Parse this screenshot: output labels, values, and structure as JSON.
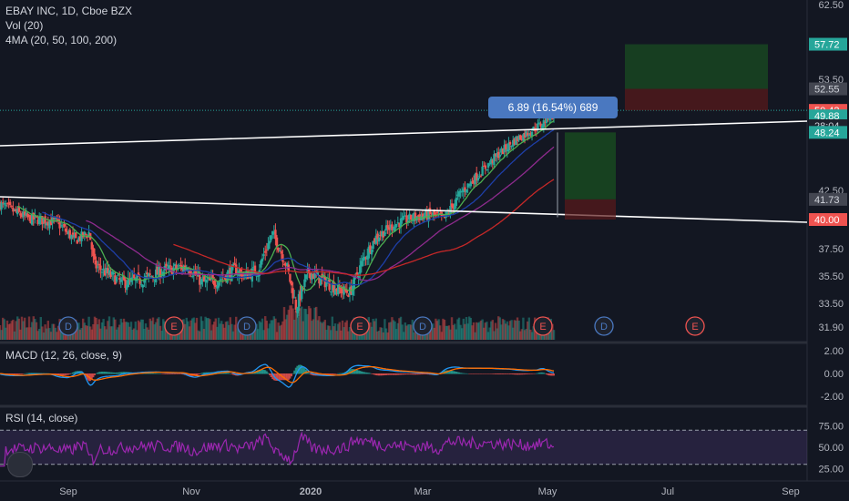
{
  "header": {
    "title": "EBAY INC, 1D, Cboe BZX",
    "vol": "Vol (20)",
    "ma": "4MA (20, 50, 100, 200)"
  },
  "macd_title": "MACD (12, 26, close, 9)",
  "rsi_title": "RSI (14, close)",
  "measure_label": "6.89 (16.54%) 689",
  "colors": {
    "background": "#131722",
    "up": "#26a69a",
    "down": "#ef5350",
    "accent_blue": "#4a78c0",
    "profit_zone": "#1b5e20",
    "loss_zone": "#5b1a1a",
    "rsi_line": "#9c27b0",
    "macd_line": "#2196f3",
    "signal_line": "#ff6d00",
    "ma20": "#4caf50",
    "ma50": "#1e3fa8",
    "ma100": "#8e2b8e",
    "ma200": "#c62828"
  },
  "events": [
    {
      "letter": "D",
      "kind": "dividend"
    },
    {
      "letter": "E",
      "kind": "earnings"
    },
    {
      "letter": "D",
      "kind": "dividend"
    },
    {
      "letter": "E",
      "kind": "earnings"
    },
    {
      "letter": "D",
      "kind": "dividend"
    },
    {
      "letter": "E",
      "kind": "earnings"
    },
    {
      "letter": "D",
      "kind": "dividend"
    },
    {
      "letter": "E",
      "kind": "earnings"
    }
  ],
  "chart_data": [
    {
      "type": "candlestick",
      "title": "EBAY INC, 1D, Cboe BZX",
      "x_ticks": [
        "Sep",
        "Nov",
        "2020",
        "Mar",
        "May",
        "Jul",
        "Sep"
      ],
      "y_ticks": [
        "62.50",
        "53.50",
        "42.50",
        "37.50",
        "35.50",
        "33.50",
        "31.90"
      ],
      "y_range": [
        31.2,
        63.0
      ],
      "price_labels": [
        {
          "text": "57.72",
          "value": 57.72,
          "style": "green"
        },
        {
          "text": "52.55",
          "value": 52.55,
          "style": "gray"
        },
        {
          "text": "50.42",
          "value": 50.42,
          "style": "red"
        },
        {
          "text": "49.88",
          "value": 49.88,
          "style": "green"
        },
        {
          "text": "28:04",
          "value": 48.9,
          "style": "dark"
        },
        {
          "text": "48.24",
          "value": 48.24,
          "style": "green"
        },
        {
          "text": "41.73",
          "value": 41.73,
          "style": "gray"
        },
        {
          "text": "40.00",
          "value": 40.0,
          "style": "red"
        }
      ],
      "measure": {
        "change": 6.89,
        "percent": 16.54,
        "bars": 689
      },
      "price_series_approx": [
        {
          "date": "2019-08",
          "close": 39.8
        },
        {
          "date": "2019-09",
          "close": 39.7
        },
        {
          "date": "2019-10",
          "close": 38.6
        },
        {
          "date": "2019-11",
          "close": 35.3
        },
        {
          "date": "2019-12",
          "close": 36.3
        },
        {
          "date": "2020-01",
          "close": 35.8
        },
        {
          "date": "2020-02",
          "close": 37.5
        },
        {
          "date": "2020-03",
          "close": 33.5
        },
        {
          "date": "2020-04",
          "close": 39.2
        },
        {
          "date": "2020-05",
          "close": 45.5
        },
        {
          "date": "2020-06",
          "close": 49.88
        }
      ]
    },
    {
      "type": "line",
      "title": "MACD (12, 26, close, 9)",
      "y_ticks": [
        "2.00",
        "0.00",
        "-2.00"
      ],
      "y_range": [
        -2.4,
        2.6
      ]
    },
    {
      "type": "line",
      "title": "RSI (14, close)",
      "y_ticks": [
        "75.00",
        "50.00",
        "25.00"
      ],
      "y_range": [
        22,
        88
      ]
    }
  ]
}
